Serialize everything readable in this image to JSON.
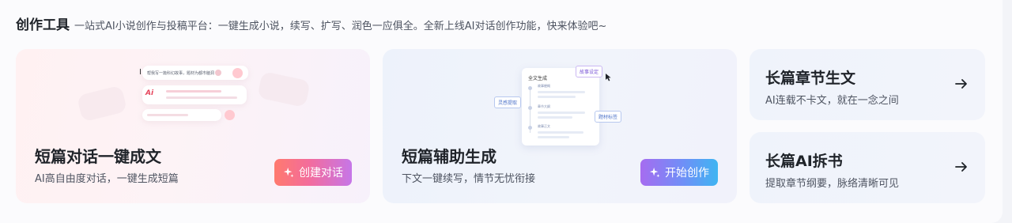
{
  "header": {
    "title": "创作工具",
    "subtitle": "一站式AI小说创作与投稿平台：一键生成小说，续写、扩写、润色一应俱全。全新上线AI对话创作功能，快来体验吧~"
  },
  "cards": {
    "dialogue": {
      "title": "短篇对话一键成文",
      "subtitle": "AI高自由度对话，一键生成短篇",
      "button_label": "创建对话",
      "illustration": {
        "input_text": "帮我写一篇科幻故事，题材为都市脑洞",
        "ai_badge": "Ai"
      }
    },
    "assist": {
      "title": "短篇辅助生成",
      "subtitle": "下文一键续写，情节无忧衔接",
      "button_label": "开始创作",
      "illustration": {
        "doc_title": "全文生成",
        "doc_items": [
          "故事梗概",
          "章节大纲",
          "故事正文"
        ],
        "tag_story": "故事设定",
        "tag_inspire": "灵感提取",
        "tag_material": "题材标签"
      }
    },
    "long_generate": {
      "title": "长篇章节生文",
      "subtitle": "AI连载不卡文，就在一念之间"
    },
    "long_split": {
      "title": "长篇AI拆书",
      "subtitle": "提取章节纲要，脉络清晰可见"
    }
  },
  "colors": {
    "accent_pink_start": "#ff7a6e",
    "accent_pink_end": "#c676e8",
    "accent_blue_start": "#a66cf0",
    "accent_blue_end": "#3fb5f2",
    "text_primary": "#1f2329",
    "text_secondary": "#4e5461"
  },
  "icons": {
    "arrow": "arrow-right-icon",
    "sparkle": "sparkle-icon"
  }
}
